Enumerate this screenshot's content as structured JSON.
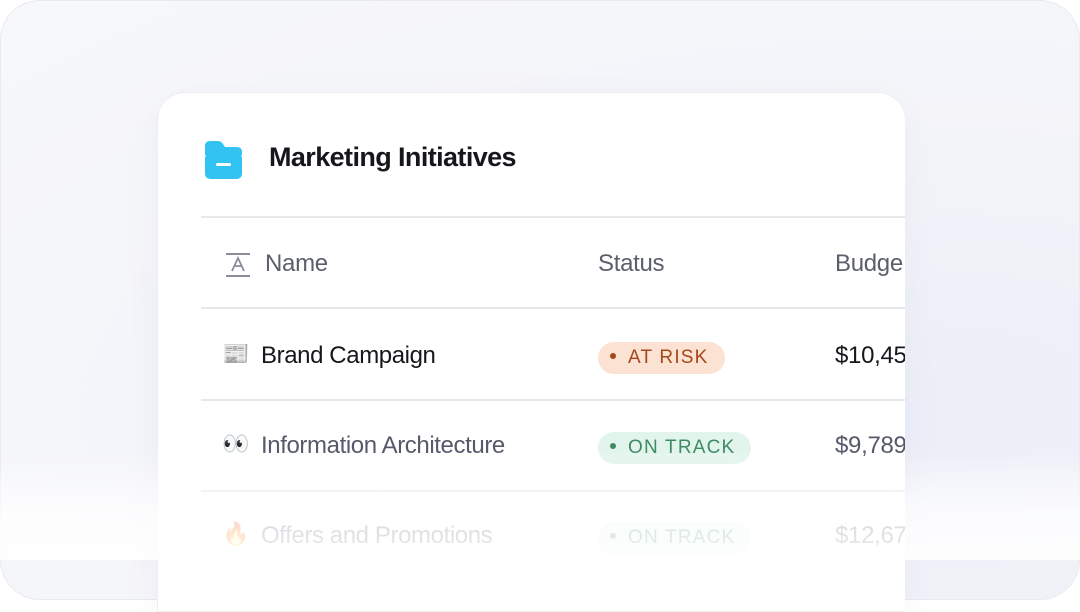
{
  "card": {
    "title": "Marketing Initiatives",
    "icon": "folder-icon",
    "icon_color": "#33c3f3"
  },
  "columns": {
    "name": "Name",
    "name_icon": "text-type-icon",
    "status": "Status",
    "budget": "Budge"
  },
  "rows": [
    {
      "emoji": "📰",
      "emoji_name": "newspaper-icon",
      "name": "Brand Campaign",
      "status": "AT RISK",
      "budget": "$10,45"
    },
    {
      "emoji": "👀",
      "emoji_name": "eyes-icon",
      "name": "Information Architecture",
      "status": "ON TRACK",
      "budget": "$9,789"
    },
    {
      "emoji": "🔥",
      "emoji_name": "fire-icon",
      "name": "Offers and Promotions",
      "status": "ON TRACK",
      "budget": "$12,67"
    }
  ],
  "status_colors": {
    "at_risk": {
      "bg": "#fbe2d2",
      "text": "#a4481c",
      "dot": "#a4481c"
    },
    "on_track": {
      "bg": "#e2f5ec",
      "text": "#3f8a63",
      "dot": "#3f8a63"
    }
  }
}
